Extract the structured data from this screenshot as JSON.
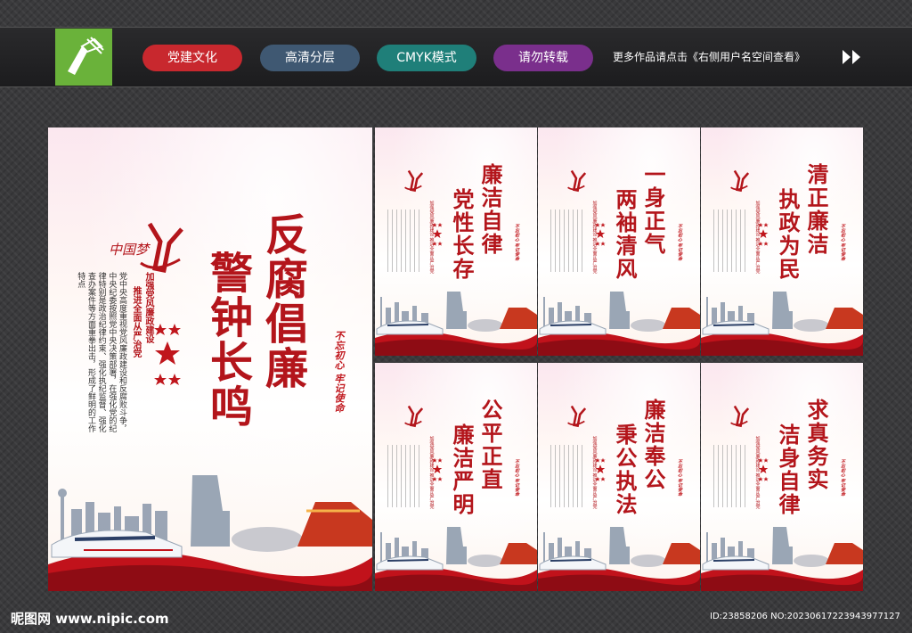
{
  "header": {
    "tags": [
      {
        "label": "党建文化",
        "color": "#c8282e"
      },
      {
        "label": "高清分层",
        "color": "#3f5872"
      },
      {
        "label": "CMYK模式",
        "color": "#1f7f79"
      },
      {
        "label": "请勿转载",
        "color": "#7a2f8c"
      }
    ],
    "more_text": "更多作品请点击《右侧用户名空间查看》"
  },
  "main_poster": {
    "title_line1": "反腐倡廉",
    "title_line2": "警钟长鸣",
    "subtitle_line1": "加强党风廉政建设",
    "subtitle_line2": "推进全面从严治党",
    "body": "党中央高度重视党风廉政建设和反腐败斗争，中央纪委按照党中央决策部署，在强化党的纪律特别是政治纪律约束、强化执纪监督、强化查办案件等方面重拳出击，形成了鲜明的工作特点",
    "motto": "不忘初心 牢记使命",
    "logo_text": "中国梦"
  },
  "small_posters": [
    {
      "line1": "廉洁自律",
      "line2": "党性长存"
    },
    {
      "line1": "一身正气",
      "line2": "两袖清风"
    },
    {
      "line1": "清正廉洁",
      "line2": "执政为民"
    },
    {
      "line1": "公平正直",
      "line2": "廉洁严明"
    },
    {
      "line1": "廉洁奉公",
      "line2": "秉公执法"
    },
    {
      "line1": "求真务实",
      "line2": "洁身自律"
    }
  ],
  "small_common": {
    "subtitle": "加强党风廉政建设 推进全面从严治党",
    "motto": "不忘初心 牢记使命"
  },
  "footer": {
    "watermark": "昵图网 www.nipic.com",
    "id_text": "ID:23858206 NO:20230617223943977127"
  },
  "colors": {
    "accent": "#b3151b",
    "logo_green": "#6ab23a"
  }
}
